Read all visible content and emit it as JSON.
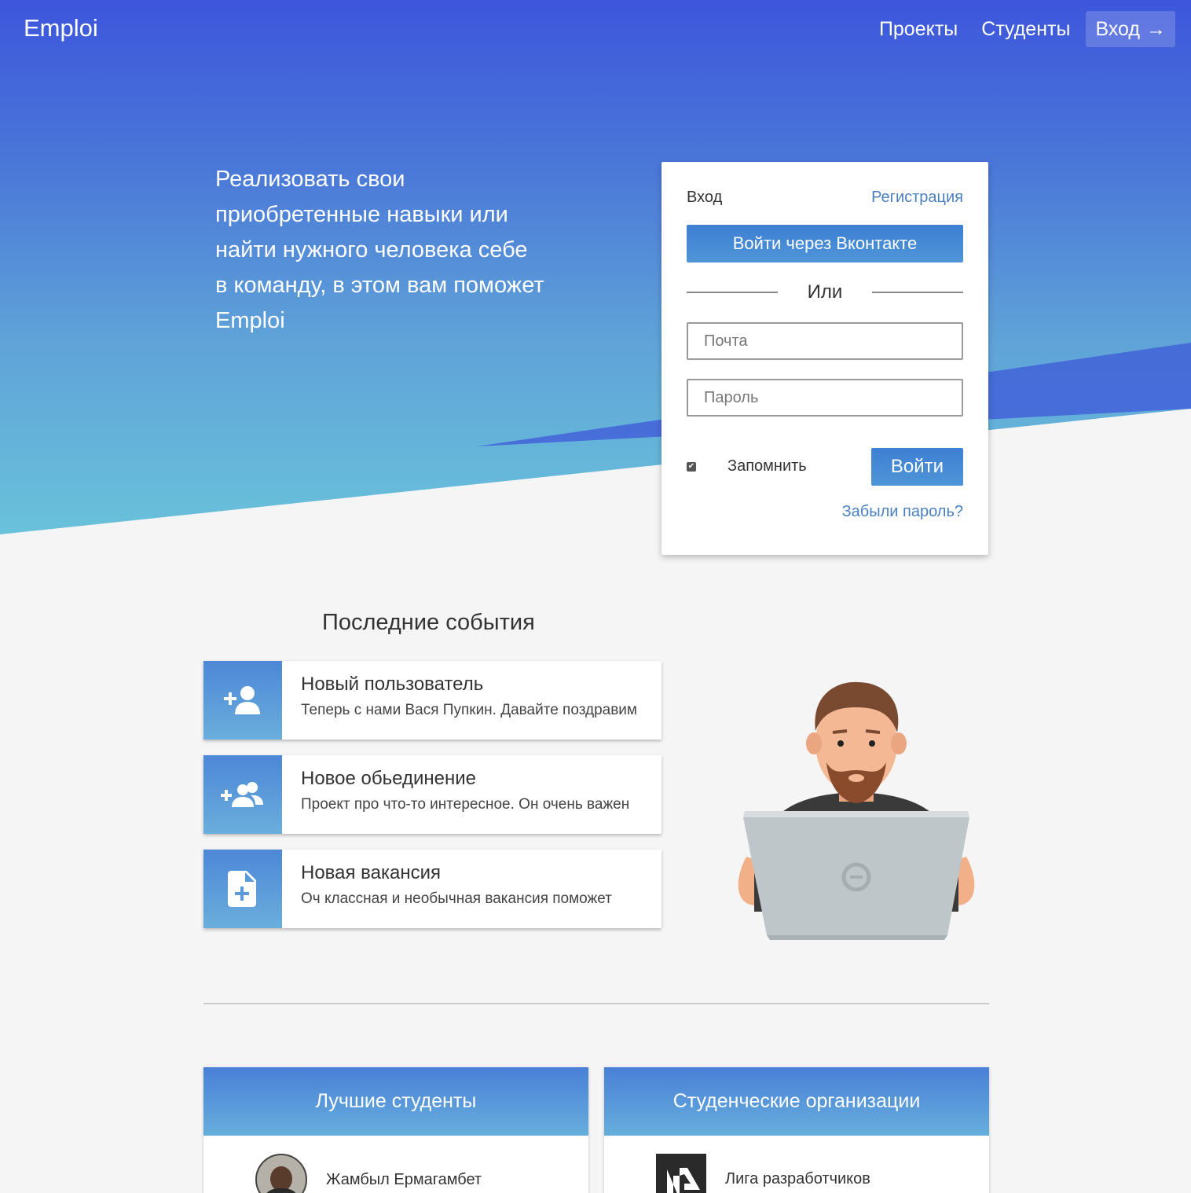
{
  "navbar": {
    "brand": "Emploi",
    "links": [
      "Проекты",
      "Студенты"
    ],
    "login_label": "Вход",
    "login_arrow": "→"
  },
  "hero": {
    "text": "Реализовать свои приобретенные навыки или найти нужного человека себе в команду, в этом вам поможет Emploi"
  },
  "login_form": {
    "title": "Вход",
    "register_link": "Регистрация",
    "vk_button": "Войти через Вконтакте",
    "or_label": "Или",
    "email_placeholder": "Почта",
    "password_placeholder": "Пароль",
    "remember_label": "Запомнить",
    "remember_checked": true,
    "submit_button": "Войти",
    "forgot_link": "Забыли пароль?"
  },
  "events": {
    "title": "Последние события",
    "items": [
      {
        "icon": "add-user-icon",
        "title": "Новый пользователь",
        "text": "Теперь с нами Вася Пупкин. Давайте поздравим"
      },
      {
        "icon": "add-group-icon",
        "title": "Новое обьединение",
        "text": "Проект про что-то интересное. Он очень важен"
      },
      {
        "icon": "add-file-icon",
        "title": "Новая вакансия",
        "text": "Оч классная и необычная вакансия поможет"
      }
    ]
  },
  "best_students": {
    "title": "Лучшие студенты",
    "items": [
      {
        "name": "Жамбыл Ермагамбет"
      }
    ]
  },
  "organizations": {
    "title": "Студенческие организации",
    "items": [
      {
        "name": "Лига разработчиков"
      }
    ]
  },
  "colors": {
    "accent": "#4a7fc0",
    "button": "#3d7fd2",
    "hero_top": "#3d56dc",
    "hero_bottom": "#6ac4db"
  }
}
